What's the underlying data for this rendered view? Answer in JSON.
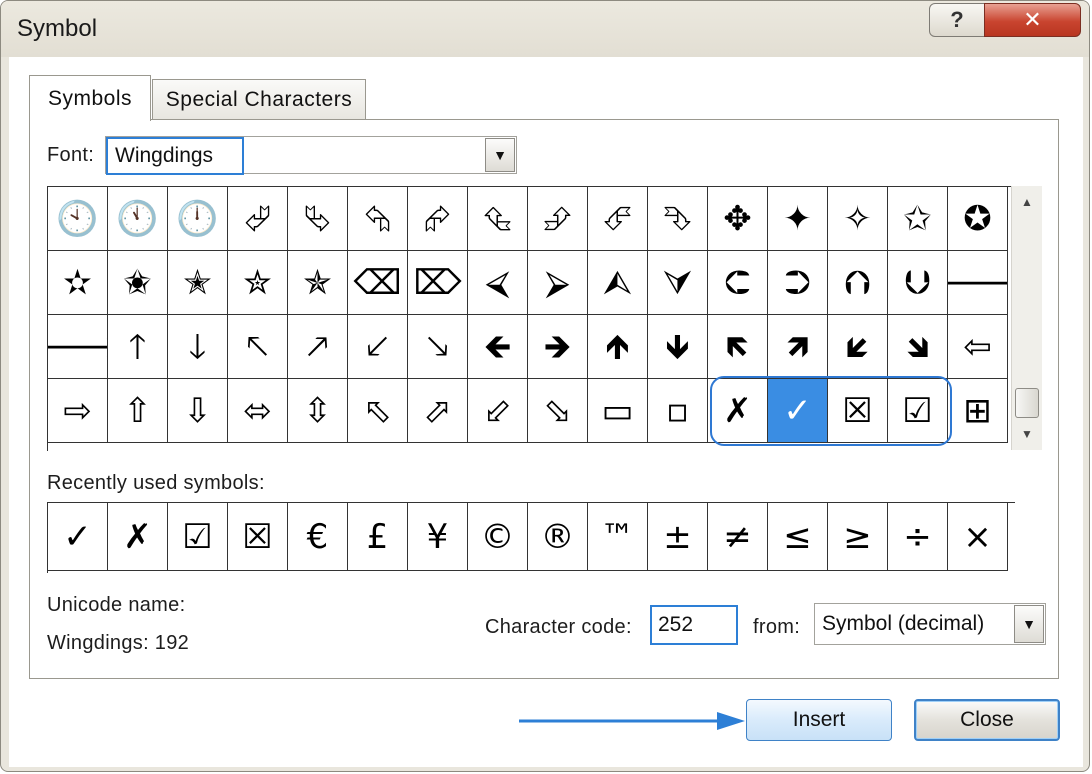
{
  "window": {
    "title": "Symbol",
    "help_label": "?",
    "close_label": "✕"
  },
  "tabs": [
    {
      "label": "Symbols",
      "selected": true
    },
    {
      "label": "Special Characters",
      "selected": false
    }
  ],
  "font": {
    "label": "Font:",
    "value": "Wingdings"
  },
  "symbol_grid": {
    "rows": [
      [
        "🕙",
        "🕚",
        "🕛",
        "⮰",
        "⮱",
        "⮲",
        "⮳",
        "⮴",
        "⮵",
        "⮶",
        "⮷",
        "✥",
        "✦",
        "✧",
        "✩",
        "✪"
      ],
      [
        "✫",
        "✬",
        "✭",
        "✮",
        "✯",
        "⌫",
        "⌦",
        "⮘",
        "⮚",
        "⮙",
        "⮛",
        "⮈",
        "⮊",
        "⮉",
        "⮋",
        "🡐"
      ],
      [
        "🡒",
        "🡑",
        "🡓",
        "🡔",
        "🡕",
        "🡗",
        "🡖",
        "🡸",
        "🡺",
        "🡹",
        "🡻",
        "🡼",
        "🡽",
        "🡿",
        "🡾",
        "⇦"
      ],
      [
        "⇨",
        "⇧",
        "⇩",
        "⬄",
        "⇳",
        "⬁",
        "⬀",
        "⬃",
        "⬂",
        "▭",
        "▫",
        "✗",
        "✓",
        "☒",
        "☑",
        "⊞"
      ]
    ],
    "selected": {
      "row": 3,
      "col": 12
    }
  },
  "recent": {
    "label": "Recently used symbols:",
    "symbols": [
      "✓",
      "✗",
      "☑",
      "☒",
      "€",
      "£",
      "¥",
      "©",
      "®",
      "™",
      "±",
      "≠",
      "≤",
      "≥",
      "÷",
      "×"
    ]
  },
  "unicode": {
    "label": "Unicode name:",
    "value": "Wingdings: 192"
  },
  "character_code": {
    "label": "Character code:",
    "value": "252"
  },
  "from": {
    "label": "from:",
    "value": "Symbol (decimal)"
  },
  "buttons": {
    "insert": "Insert",
    "close": "Close"
  },
  "colors": {
    "accent": "#2d7fd6",
    "selection": "#3a8de3",
    "title_close": "#c9442f"
  }
}
